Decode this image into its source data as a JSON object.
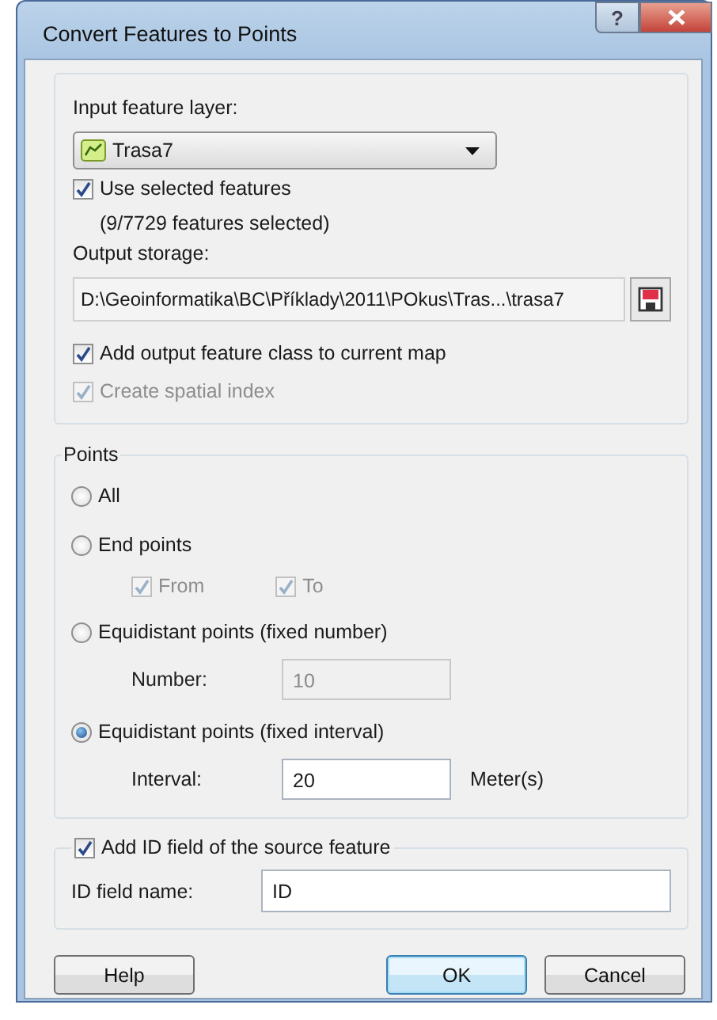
{
  "window": {
    "title": "Convert Features to Points",
    "help_glyph": "?"
  },
  "input": {
    "layer_label": "Input feature layer:",
    "layer_value": "Trasa7",
    "use_selected": {
      "label": "Use selected features",
      "checked": true,
      "disabled": false
    },
    "selection_info": "(9/7729 features selected)",
    "storage_label": "Output storage:",
    "storage_value": "D:\\Geoinformatika\\BC\\Příklady\\2011\\POkus\\Tras...\\trasa7",
    "options": [
      {
        "label": "Add output feature class to current map",
        "checked": true,
        "disabled": false
      },
      {
        "label": "Create spatial index",
        "checked": true,
        "disabled": true
      }
    ]
  },
  "points": {
    "legend": "Points",
    "options": [
      {
        "kind": "plain",
        "label": "All",
        "selected": false
      },
      {
        "kind": "checks",
        "label": "End points",
        "selected": false,
        "checks": [
          {
            "label": "From",
            "checked": true,
            "disabled": true
          },
          {
            "label": "To",
            "checked": true,
            "disabled": true
          }
        ]
      },
      {
        "kind": "field",
        "label": "Equidistant points (fixed number)",
        "selected": false,
        "field": {
          "label": "Number:",
          "value": "10",
          "disabled": true
        }
      },
      {
        "kind": "field",
        "label": "Equidistant points (fixed interval)",
        "selected": true,
        "field": {
          "label": "Interval:",
          "value": "20",
          "unit": "Meter(s)",
          "disabled": false
        }
      }
    ]
  },
  "id_field": {
    "check": {
      "label": "Add ID field of the source feature",
      "checked": true,
      "disabled": false
    },
    "name_label": "ID field name:",
    "value": "ID"
  },
  "buttons": [
    {
      "label": "Help",
      "default": false
    },
    {
      "label": "OK",
      "default": true
    },
    {
      "label": "Cancel",
      "default": false
    }
  ]
}
